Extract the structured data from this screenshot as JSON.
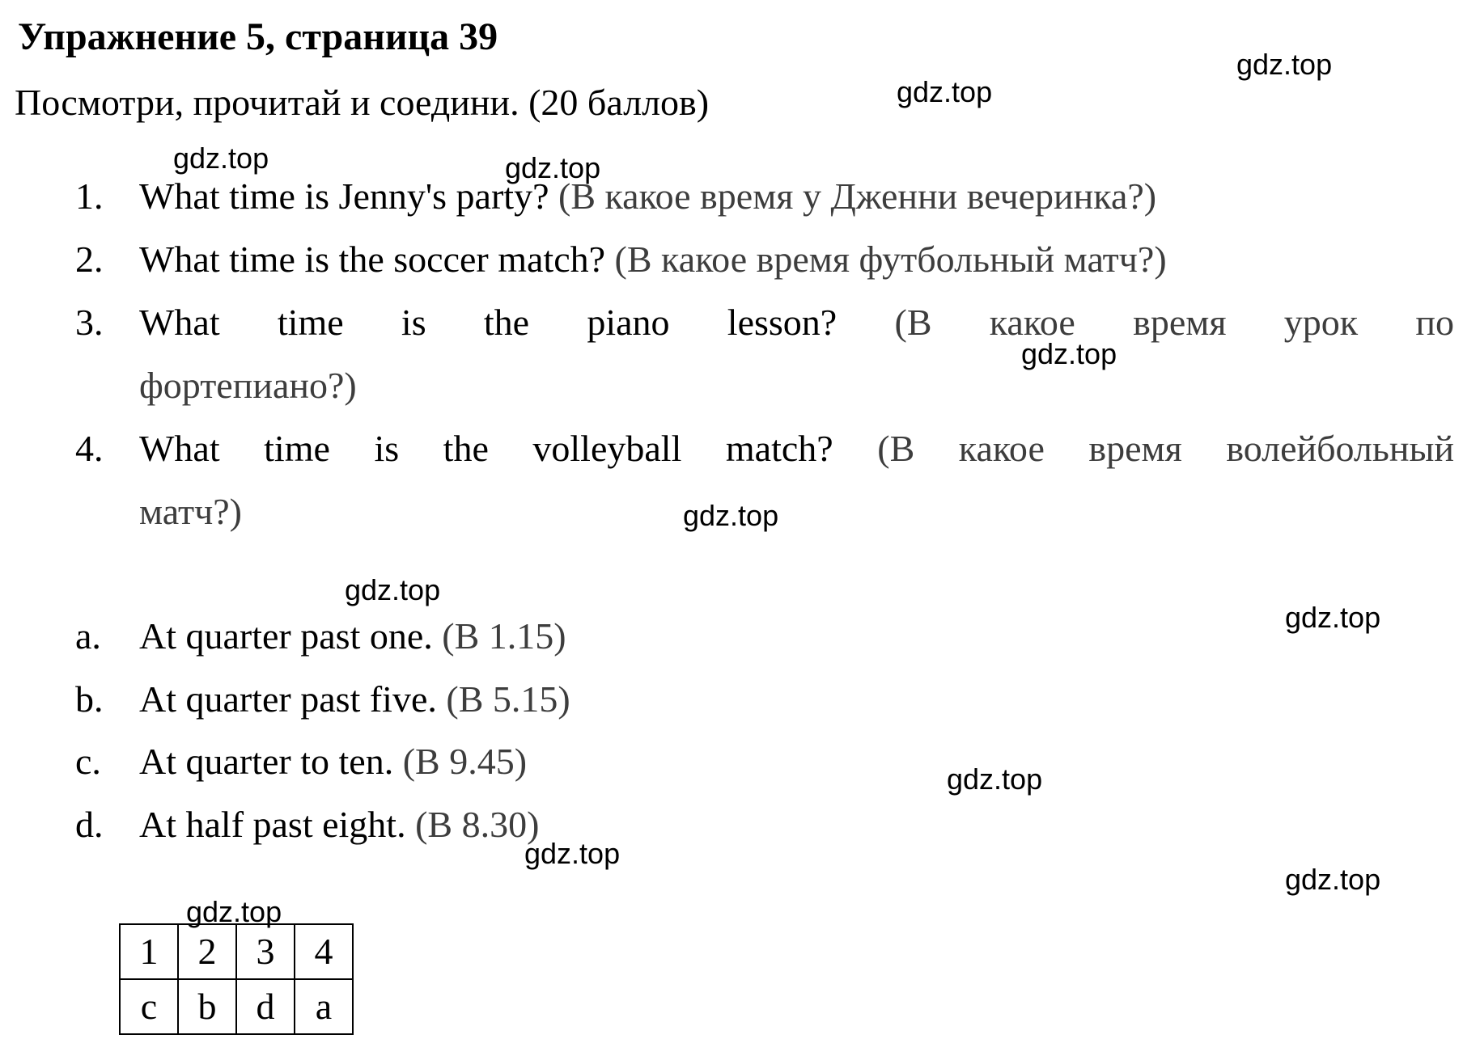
{
  "header": {
    "title": "Упражнение 5, страница 39",
    "instruction": "Посмотри, прочитай и соедини. (20 баллов)"
  },
  "questions": [
    {
      "number": "1.",
      "text": "What time is Jenny's party?",
      "translation": "(В какое время у Дженни вечеринка?)"
    },
    {
      "number": "2.",
      "text": "What time is the soccer match?",
      "translation": "(В какое время футбольный матч?)"
    },
    {
      "number": "3.",
      "text": "What time is the piano lesson?",
      "translation_line1": "(В какое время урок по",
      "translation_line2": "фортепиано?)"
    },
    {
      "number": "4.",
      "text": "What time is the volleyball match?",
      "translation_line1": "(В какое время волейбольный",
      "translation_line2": "матч?)"
    }
  ],
  "options": [
    {
      "letter": "a.",
      "text": "At quarter past one.",
      "translation": "(В 1.15)"
    },
    {
      "letter": "b.",
      "text": "At quarter past five.",
      "translation": "(В 5.15)"
    },
    {
      "letter": "c.",
      "text": "At quarter to ten.",
      "translation": "(В 9.45)"
    },
    {
      "letter": "d.",
      "text": "At half past eight.",
      "translation": "(В 8.30)"
    }
  ],
  "answer_table": {
    "header": [
      "1",
      "2",
      "3",
      "4"
    ],
    "answers": [
      "c",
      "b",
      "d",
      "a"
    ]
  },
  "watermark": {
    "text": "gdz.top"
  },
  "colors": {
    "text": "#000000",
    "translation": "#3d3d3d",
    "background": "#ffffff"
  }
}
